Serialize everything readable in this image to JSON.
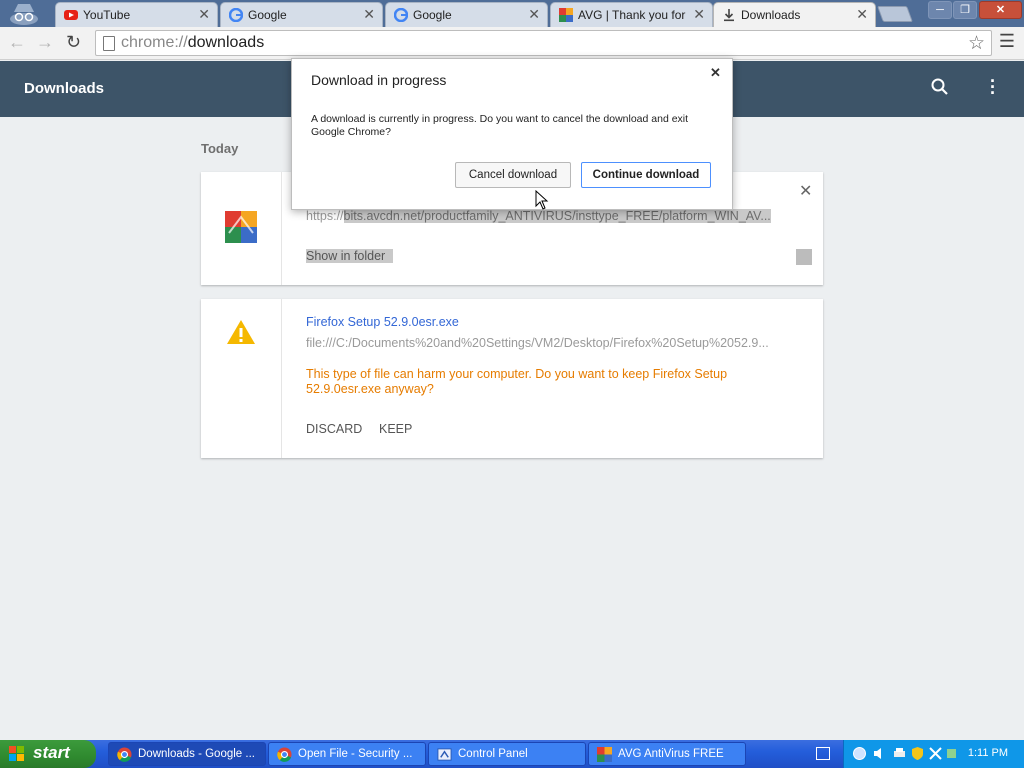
{
  "tabs": [
    {
      "label": "YouTube",
      "icon": "youtube-icon"
    },
    {
      "label": "Google",
      "icon": "google-icon"
    },
    {
      "label": "Google",
      "icon": "google-icon"
    },
    {
      "label": "AVG | Thank you for d",
      "icon": "avg-icon"
    },
    {
      "label": "Downloads",
      "icon": "download-icon"
    }
  ],
  "omnibox": {
    "scheme": "chrome://",
    "path": "downloads"
  },
  "header": {
    "title": "Downloads"
  },
  "section_date": "Today",
  "downloads": [
    {
      "url_prefix": "https://",
      "url_highlighted": "bits.avcdn.net/productfamily_ANTIVIRUS/insttype_FREE/platform_WIN_AV...",
      "action": "Show in folder"
    },
    {
      "name": "Firefox Setup 52.9.0esr.exe",
      "url": "file:///C:/Documents%20and%20Settings/VM2/Desktop/Firefox%20Setup%2052.9...",
      "warning": "This type of file can harm your computer. Do you want to keep Firefox Setup 52.9.0esr.exe anyway?",
      "discard_label": "DISCARD",
      "keep_label": "KEEP"
    }
  ],
  "dialog": {
    "title": "Download in progress",
    "message": "A download is currently in progress. Do you want to cancel the download and exit Google Chrome?",
    "cancel_label": "Cancel download",
    "continue_label": "Continue download"
  },
  "taskbar": {
    "start_label": "start",
    "tasks": [
      {
        "label": "Downloads - Google ...",
        "icon": "chrome-icon"
      },
      {
        "label": "Open File - Security ...",
        "icon": "chrome-icon"
      },
      {
        "label": "Control Panel",
        "icon": "control-panel-icon"
      },
      {
        "label": "AVG AntiVirus FREE",
        "icon": "avg-icon"
      }
    ],
    "clock": "1:11 PM"
  },
  "colors": {
    "header_bg": "#3d5468",
    "link": "#3367d6",
    "warning": "#e67c00",
    "taskbar": "#245edb"
  }
}
